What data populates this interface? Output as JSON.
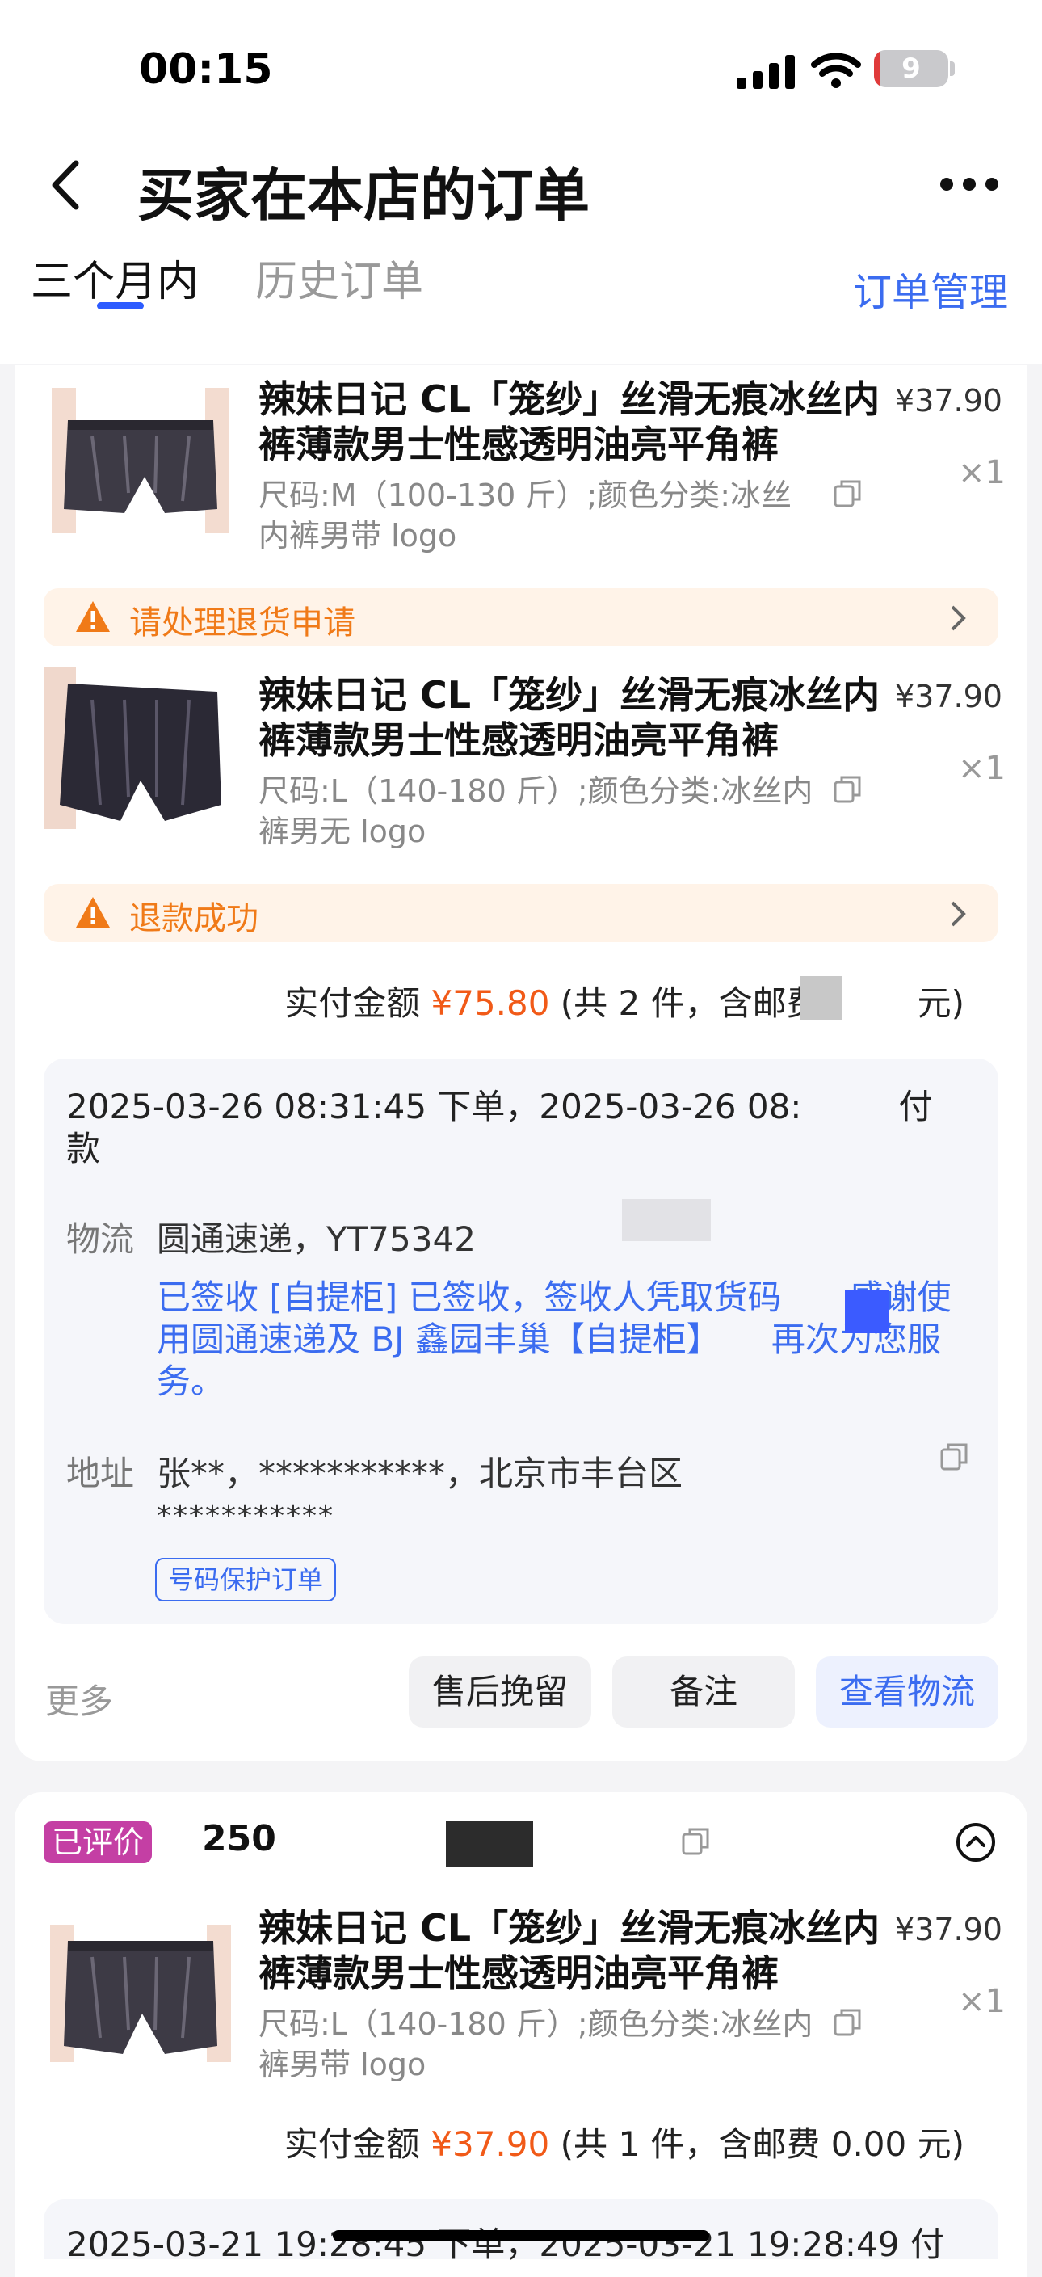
{
  "status_bar": {
    "time": "00:15",
    "battery": "9"
  },
  "header": {
    "title": "买家在本店的订单",
    "tabs": [
      {
        "label": "三个月内"
      },
      {
        "label": "历史订单"
      }
    ],
    "manage": "订单管理"
  },
  "order1": {
    "items": [
      {
        "title": "辣妹日记 CL「笼纱」丝滑无痕冰丝内裤薄款男士性感透明油亮平角裤",
        "price": "¥37.90",
        "qty": "×1",
        "spec": "尺码:M（100-130 斤）;颜色分类:冰丝内裤男带 logo"
      },
      {
        "title": "辣妹日记 CL「笼纱」丝滑无痕冰丝内裤薄款男士性感透明油亮平角裤",
        "price": "¥37.90",
        "qty": "×1",
        "spec": "尺码:L（140-180 斤）;颜色分类:冰丝内裤男无 logo"
      }
    ],
    "notices": [
      "请处理退货申请",
      "退款成功"
    ],
    "total_label": "实付金额",
    "total_amount": "¥75.80",
    "total_detail_prefix": "(共 2 件，含邮费",
    "total_detail_suffix": "元)",
    "timestamps": "2025-03-26 08:31:45 下单，2025-03-26 08:",
    "timestamps_end": "付款",
    "shipping_label": "物流",
    "shipping_carrier": "圆通速递，YT75342",
    "logistics_status": "已签收 [自提柜] 已签收，签收人凭取货码　　感谢使用圆通速递及 BJ 鑫园丰巢【自提柜】　　再次为您服务。",
    "address_label": "地址",
    "address": "张**，***********，北京市丰台区",
    "address_line2": "***********",
    "protect_tag": "号码保护订单",
    "more": "更多",
    "buttons": [
      "售后挽留",
      "备注",
      "查看物流"
    ]
  },
  "order2": {
    "badge": "已评价",
    "order_no": "250",
    "items": [
      {
        "title": "辣妹日记 CL「笼纱」丝滑无痕冰丝内裤薄款男士性感透明油亮平角裤",
        "price": "¥37.90",
        "qty": "×1",
        "spec": "尺码:L（140-180 斤）;颜色分类:冰丝内裤男带 logo"
      }
    ],
    "total_label": "实付金额",
    "total_amount": "¥37.90",
    "total_detail": "(共 1 件，含邮费 0.00 元)",
    "timestamps": "2025-03-21 19:28:45 下单，2025-03-21 19:28:49 付"
  }
}
